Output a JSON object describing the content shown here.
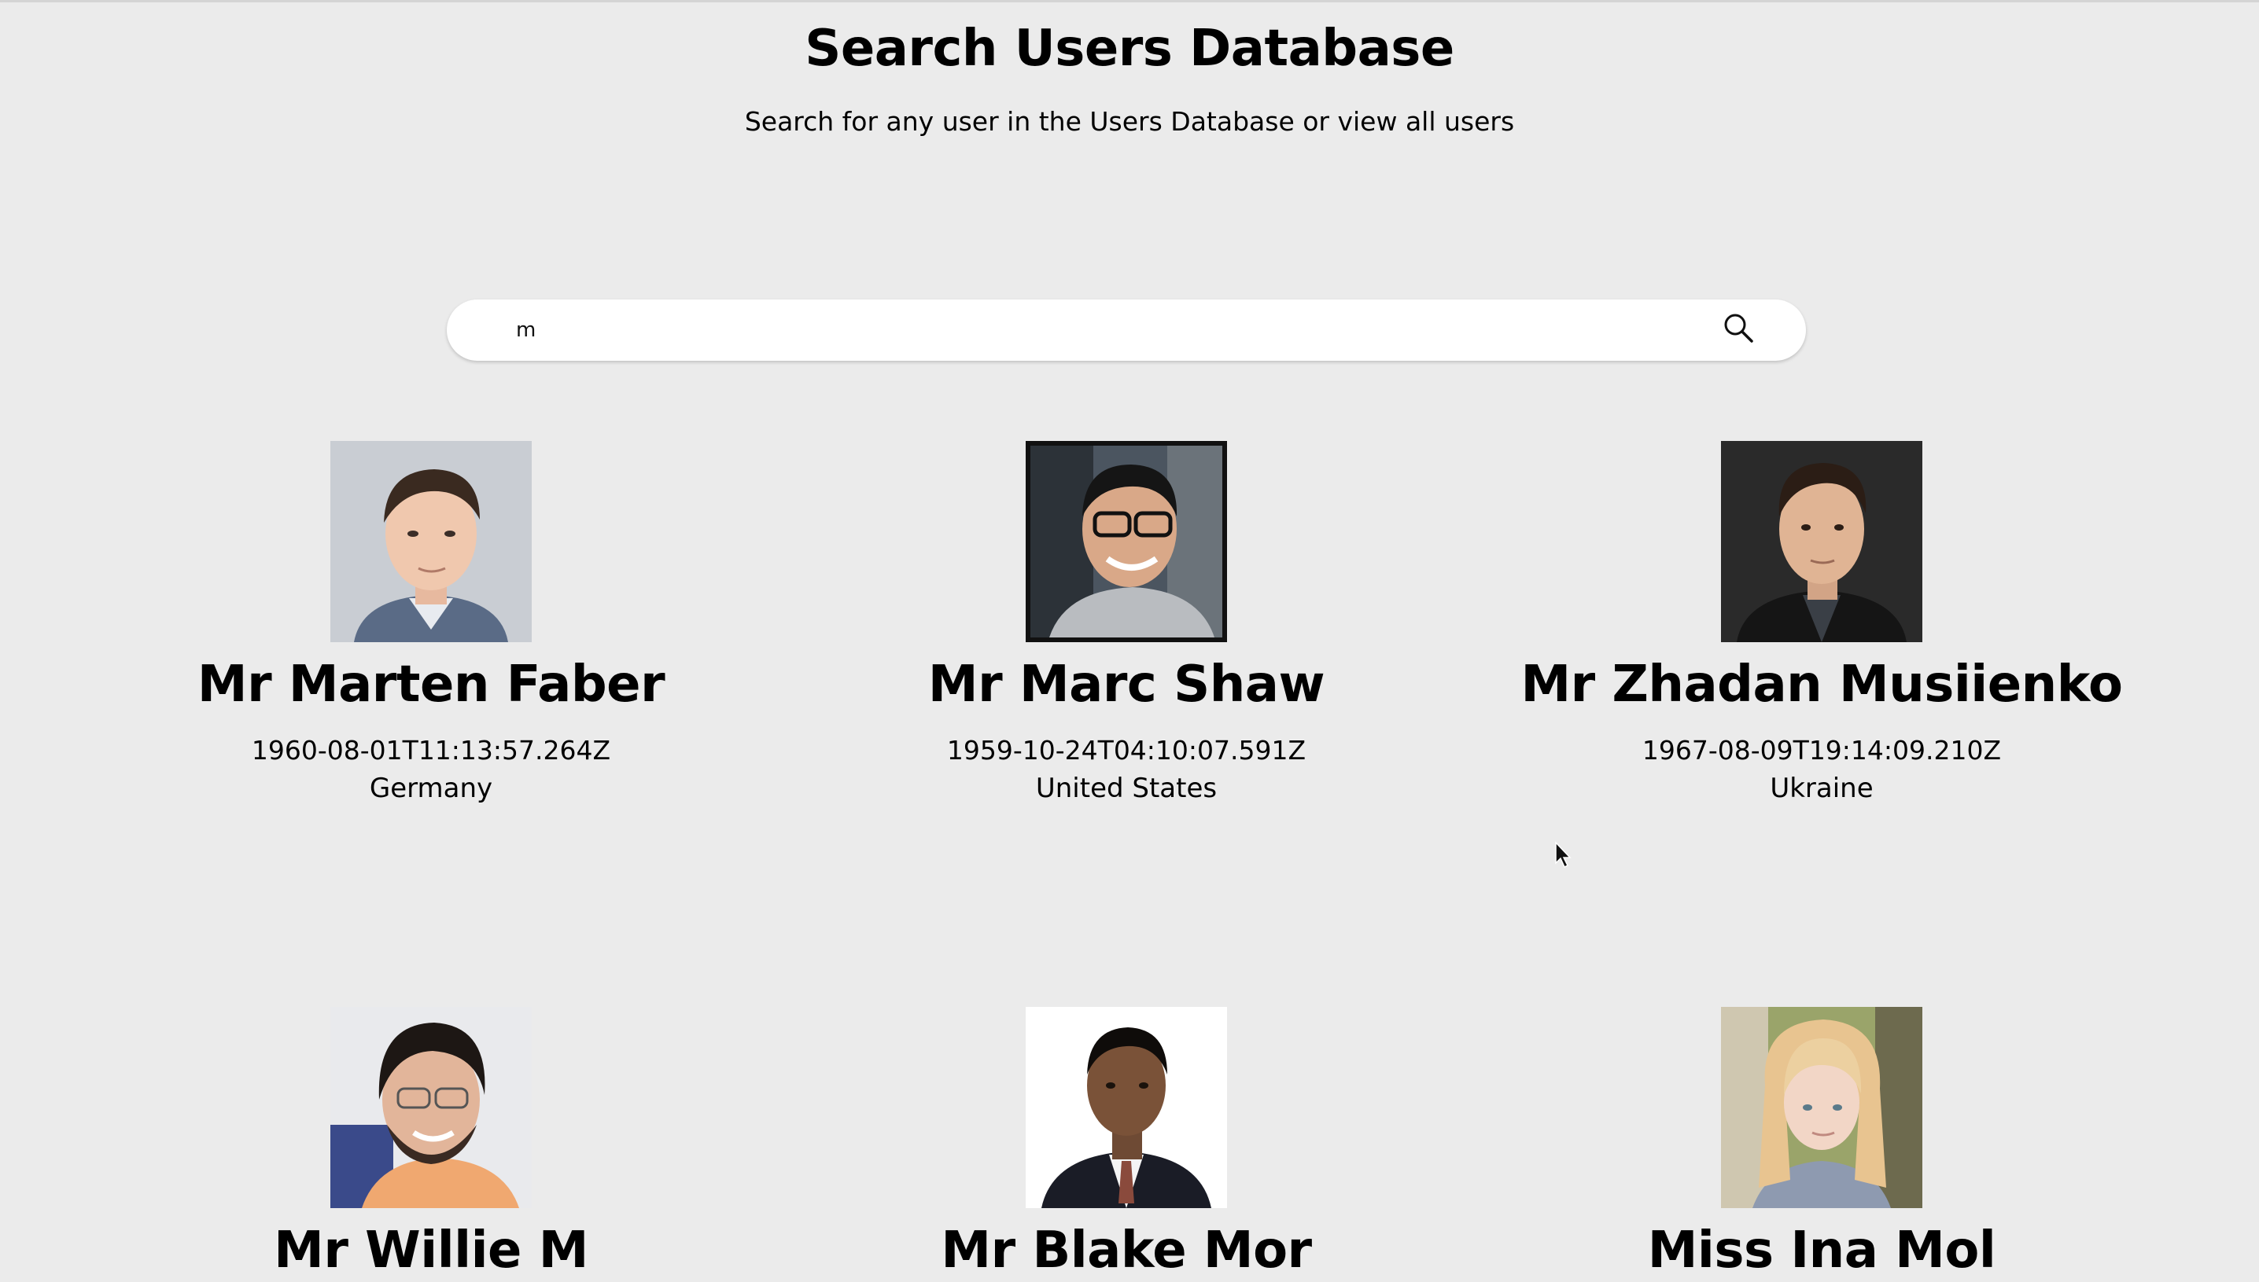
{
  "header": {
    "title": "Search Users Database",
    "subtitle": "Search for any user in the Users Database or view all users"
  },
  "search": {
    "value": "m",
    "icon": "search-icon"
  },
  "users": [
    {
      "name": "Mr Marten Faber",
      "dob": "1960-08-01T11:13:57.264Z",
      "country": "Germany"
    },
    {
      "name": "Mr Marc Shaw",
      "dob": "1959-10-24T04:10:07.591Z",
      "country": "United States"
    },
    {
      "name": "Mr Zhadan Musiienko",
      "dob": "1967-08-09T19:14:09.210Z",
      "country": "Ukraine"
    },
    {
      "name": "Mr Willie M",
      "dob": "",
      "country": ""
    },
    {
      "name": "Mr Blake Mor",
      "dob": "",
      "country": ""
    },
    {
      "name": "Miss Ina Mol",
      "dob": "",
      "country": ""
    }
  ],
  "colors": {
    "background": "#ebebeb",
    "search_bg": "#ffffff",
    "text": "#000000"
  }
}
